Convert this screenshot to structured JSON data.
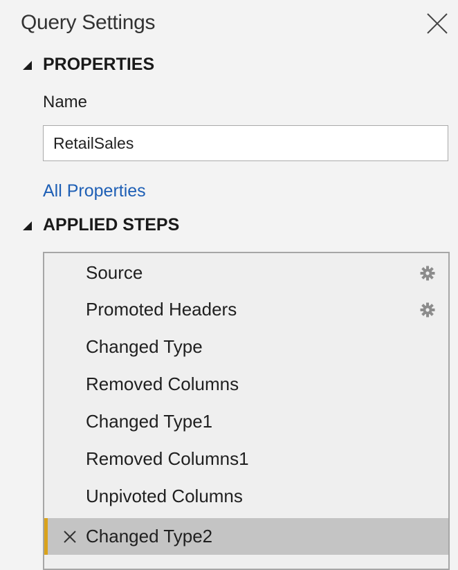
{
  "panel": {
    "title": "Query Settings"
  },
  "properties": {
    "header": "PROPERTIES",
    "name_label": "Name",
    "name_value": "RetailSales",
    "all_properties_link": "All Properties"
  },
  "applied_steps": {
    "header": "APPLIED STEPS",
    "steps": [
      {
        "label": "Source",
        "has_settings": true
      },
      {
        "label": "Promoted Headers",
        "has_settings": true
      },
      {
        "label": "Changed Type",
        "has_settings": false
      },
      {
        "label": "Removed Columns",
        "has_settings": false
      },
      {
        "label": "Changed Type1",
        "has_settings": false
      },
      {
        "label": "Removed Columns1",
        "has_settings": false
      },
      {
        "label": "Unpivoted Columns",
        "has_settings": false
      },
      {
        "label": "Changed Type2",
        "has_settings": false,
        "selected": true
      }
    ]
  },
  "icons": {
    "close": "close-icon",
    "collapse": "triangle-collapse-icon",
    "settings": "gear-icon",
    "delete_step": "x-icon"
  },
  "colors": {
    "link": "#1e5fb5",
    "selected_step_bg": "#c4c4c4",
    "selected_step_accent": "#d9a21b"
  }
}
